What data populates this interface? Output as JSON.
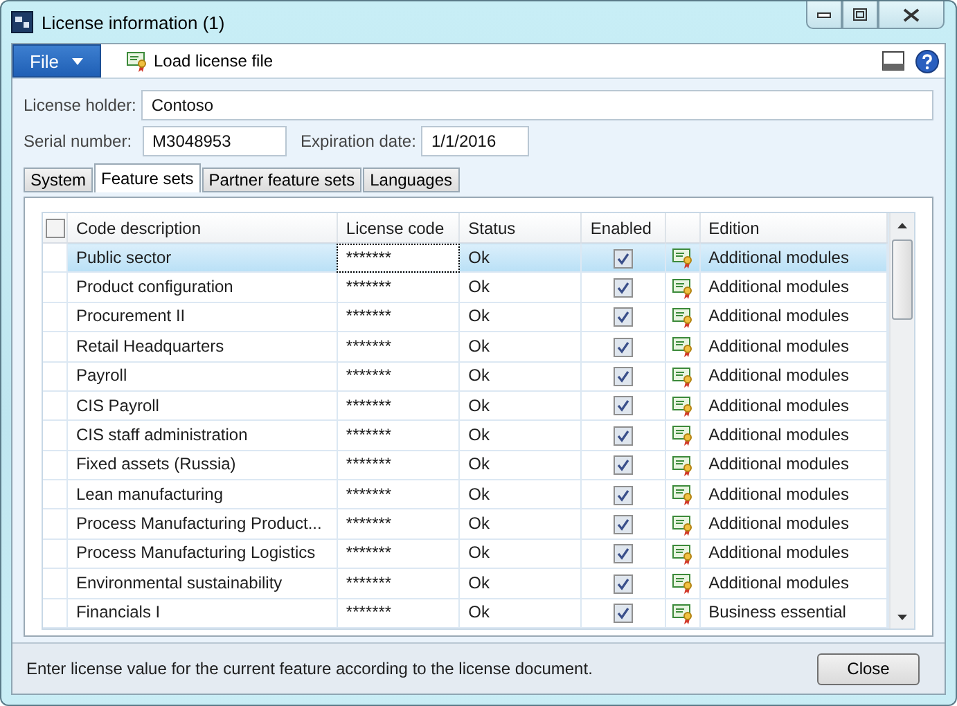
{
  "window": {
    "title": "License information (1)"
  },
  "toolbar": {
    "file_menu": "File",
    "load_button": "Load license file"
  },
  "form": {
    "license_holder": {
      "label": "License holder:",
      "value": "Contoso"
    },
    "serial_number": {
      "label": "Serial number:",
      "value": "M3048953"
    },
    "expiration_date": {
      "label": "Expiration date:",
      "value": "1/1/2016"
    }
  },
  "tabs": [
    {
      "label": "System",
      "selected": false
    },
    {
      "label": "Feature sets",
      "selected": true
    },
    {
      "label": "Partner feature sets",
      "selected": false
    },
    {
      "label": "Languages",
      "selected": false
    }
  ],
  "table": {
    "select_all_checked": false,
    "columns": [
      "Code description",
      "License code",
      "Status",
      "Enabled",
      "Edition"
    ],
    "rows": [
      {
        "description": "Public sector",
        "code": "*******",
        "status": "Ok",
        "enabled": true,
        "edition": "Additional modules",
        "selected": true
      },
      {
        "description": "Product configuration",
        "code": "*******",
        "status": "Ok",
        "enabled": true,
        "edition": "Additional modules",
        "selected": false
      },
      {
        "description": "Procurement II",
        "code": "*******",
        "status": "Ok",
        "enabled": true,
        "edition": "Additional modules",
        "selected": false
      },
      {
        "description": "Retail Headquarters",
        "code": "*******",
        "status": "Ok",
        "enabled": true,
        "edition": "Additional modules",
        "selected": false
      },
      {
        "description": "Payroll",
        "code": "*******",
        "status": "Ok",
        "enabled": true,
        "edition": "Additional modules",
        "selected": false
      },
      {
        "description": "CIS Payroll",
        "code": "*******",
        "status": "Ok",
        "enabled": true,
        "edition": "Additional modules",
        "selected": false
      },
      {
        "description": "CIS staff administration",
        "code": "*******",
        "status": "Ok",
        "enabled": true,
        "edition": "Additional modules",
        "selected": false
      },
      {
        "description": "Fixed assets (Russia)",
        "code": "*******",
        "status": "Ok",
        "enabled": true,
        "edition": "Additional modules",
        "selected": false
      },
      {
        "description": "Lean manufacturing",
        "code": "*******",
        "status": "Ok",
        "enabled": true,
        "edition": "Additional modules",
        "selected": false
      },
      {
        "description": "Process Manufacturing Product...",
        "code": "*******",
        "status": "Ok",
        "enabled": true,
        "edition": "Additional modules",
        "selected": false
      },
      {
        "description": "Process Manufacturing Logistics",
        "code": "*******",
        "status": "Ok",
        "enabled": true,
        "edition": "Additional modules",
        "selected": false
      },
      {
        "description": "Environmental sustainability",
        "code": "*******",
        "status": "Ok",
        "enabled": true,
        "edition": "Additional modules",
        "selected": false
      },
      {
        "description": "Financials I",
        "code": "*******",
        "status": "Ok",
        "enabled": true,
        "edition": "Business essential",
        "selected": false
      }
    ]
  },
  "status_bar": {
    "text": "Enter license value for the current feature according to the license document.",
    "close_button": "Close"
  }
}
